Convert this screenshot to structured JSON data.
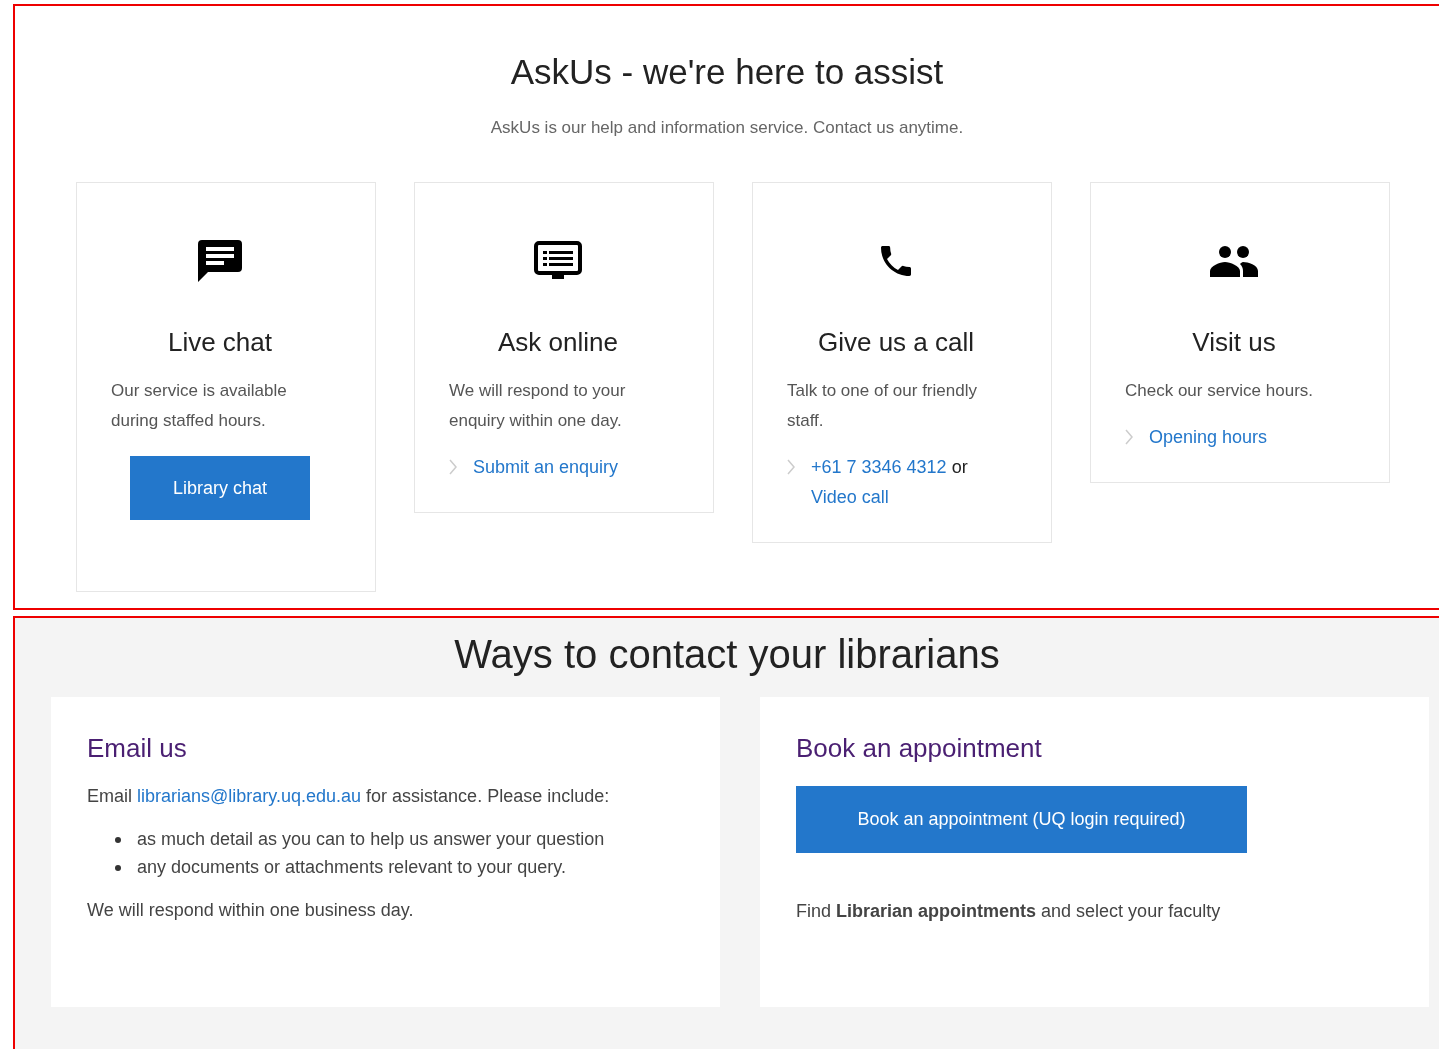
{
  "askus": {
    "title": "AskUs - we're here to assist",
    "subtitle": "AskUs is our help and information service. Contact us anytime.",
    "cards": [
      {
        "kind": "chat",
        "title": "Live chat",
        "text": "Our service is available during staffed hours.",
        "action": {
          "kind": "button",
          "label": "Library chat"
        }
      },
      {
        "kind": "monitor",
        "title": "Ask online",
        "text": "We will respond to your enquiry within one day.",
        "action": {
          "kind": "links",
          "parts": [
            {
              "text": "Submit an enquiry",
              "link": true
            }
          ]
        }
      },
      {
        "kind": "phone",
        "title": "Give us a call",
        "text": "Talk to one of our friendly staff.",
        "action": {
          "kind": "links",
          "parts": [
            {
              "text": "+61 7 3346 4312",
              "link": true
            },
            {
              "text": "or",
              "link": false
            },
            {
              "text": "Video call",
              "link": true
            }
          ]
        }
      },
      {
        "kind": "people",
        "title": "Visit us",
        "text": "Check our service hours.",
        "action": {
          "kind": "links",
          "parts": [
            {
              "text": "Opening hours",
              "link": true
            }
          ]
        }
      }
    ]
  },
  "contact": {
    "title": "Ways to contact your librarians",
    "email": {
      "title": "Email us",
      "intro_before": "Email",
      "intro_link": "librarians@library.uq.edu.au",
      "intro_after": "for assistance. Please include:",
      "bullets": [
        "as much detail as you can to help us answer your question",
        "any documents or attachments relevant to your query."
      ],
      "footer": "We will respond within one business day."
    },
    "appointment": {
      "title": "Book an appointment",
      "button": "Book an appointment (UQ login required)",
      "note": "Find **Librarian appointments** and select your faculty"
    }
  }
}
